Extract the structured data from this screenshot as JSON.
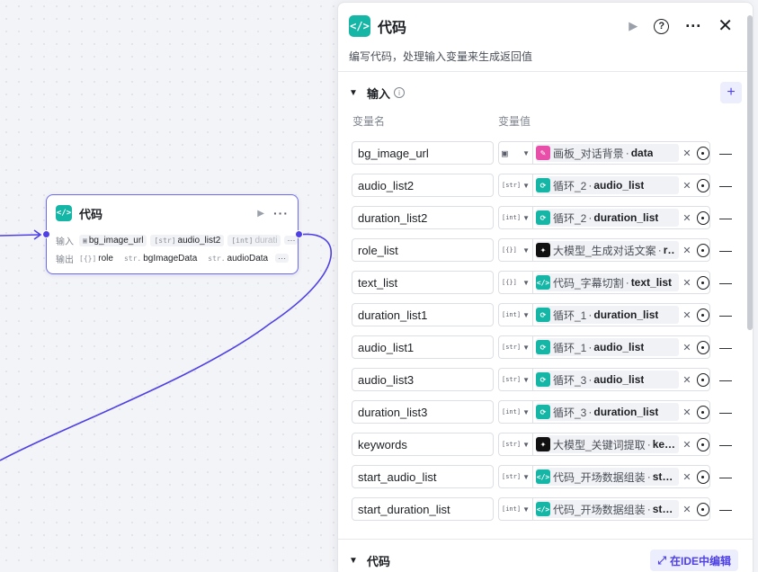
{
  "node": {
    "title": "代码",
    "input_label": "输入",
    "output_label": "输出",
    "inputs": [
      {
        "type": "img",
        "name": "bg_image_url"
      },
      {
        "type": "[str]",
        "name": "audio_list2"
      },
      {
        "type": "[int]",
        "name": "durati"
      }
    ],
    "outputs": [
      {
        "type": "[{}]",
        "name": "role"
      },
      {
        "type": "str.",
        "name": "bgImageData"
      },
      {
        "type": "str.",
        "name": "audioData"
      }
    ],
    "more": "···"
  },
  "panel": {
    "title": "代码",
    "description": "编写代码，处理输入变量来生成返回值",
    "input_section_title": "输入",
    "col_name": "变量名",
    "col_value": "变量值",
    "code_section_title": "代码",
    "ide_button": "在IDE中编辑",
    "variables": [
      {
        "name": "bg_image_url",
        "type": "img",
        "icon": "board",
        "node": "画板_对话背景",
        "field": "data"
      },
      {
        "name": "audio_list2",
        "type": "[str]",
        "icon": "loop",
        "node": "循环_2",
        "field": "audio_list"
      },
      {
        "name": "duration_list2",
        "type": "[int]",
        "icon": "loop",
        "node": "循环_2",
        "field": "duration_list"
      },
      {
        "name": "role_list",
        "type": "[{}]",
        "icon": "llm",
        "node": "大模型_生成对话文案",
        "field": "r…"
      },
      {
        "name": "text_list",
        "type": "[{}]",
        "icon": "code",
        "node": "代码_字幕切割",
        "field": "text_list"
      },
      {
        "name": "duration_list1",
        "type": "[int]",
        "icon": "loop",
        "node": "循环_1",
        "field": "duration_list"
      },
      {
        "name": "audio_list1",
        "type": "[str]",
        "icon": "loop",
        "node": "循环_1",
        "field": "audio_list"
      },
      {
        "name": "audio_list3",
        "type": "[str]",
        "icon": "loop",
        "node": "循环_3",
        "field": "audio_list"
      },
      {
        "name": "duration_list3",
        "type": "[int]",
        "icon": "loop",
        "node": "循环_3",
        "field": "duration_list"
      },
      {
        "name": "keywords",
        "type": "[str]",
        "icon": "llm",
        "node": "大模型_关键词提取",
        "field": "ke…"
      },
      {
        "name": "start_audio_list",
        "type": "[str]",
        "icon": "code",
        "node": "代码_开场数据组装",
        "field": "sta…"
      },
      {
        "name": "start_duration_list",
        "type": "[int]",
        "icon": "code",
        "node": "代码_开场数据组装",
        "field": "sta…"
      }
    ]
  },
  "colors": {
    "accent": "#4e40e5",
    "code_icon": "#15b6a5",
    "board_icon": "#e84fa8",
    "llm_icon": "#111111"
  }
}
